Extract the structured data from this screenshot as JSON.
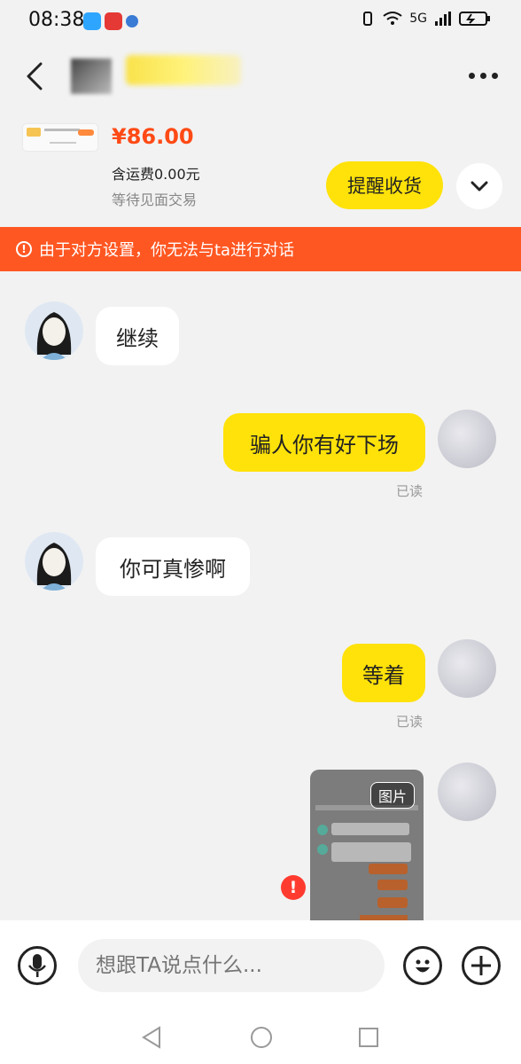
{
  "status_bar": {
    "time": "08:38",
    "icons": [
      "message-icon",
      "app-icon",
      "app-small-icon"
    ],
    "right_text": "5G"
  },
  "header": {
    "back_icon": "back-icon",
    "more_icon": "more-icon"
  },
  "product": {
    "price": "¥86.00",
    "shipping": "含运费0.00元",
    "status": "等待见面交易",
    "remind_label": "提醒收货"
  },
  "banner": {
    "text": "由于对方设置，你无法与ta进行对话",
    "icon": "!"
  },
  "messages": [
    {
      "side": "left",
      "text": "继续"
    },
    {
      "side": "right",
      "text": "骗人你有好下场",
      "status": "已读"
    },
    {
      "side": "left",
      "text": "你可真惨啊"
    },
    {
      "side": "right",
      "text": "等着",
      "status": "已读"
    },
    {
      "side": "right",
      "type": "image",
      "tag": "图片",
      "error": "!"
    }
  ],
  "input": {
    "placeholder": "想跟TA说点什么..."
  },
  "colors": {
    "accent_yellow": "#ffe20a",
    "banner_orange": "#ff5722",
    "price_red": "#ff4a15"
  }
}
